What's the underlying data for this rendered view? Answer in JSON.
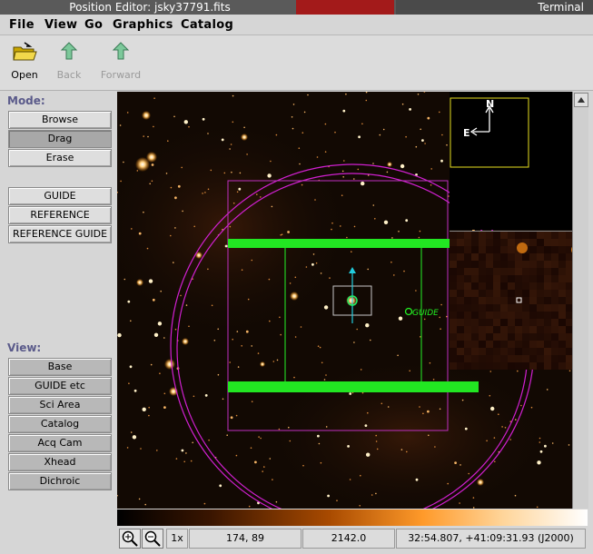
{
  "window": {
    "title": "Position Editor: jsky37791.fits",
    "other_window": "Terminal"
  },
  "menu": {
    "items": [
      "File",
      "View",
      "Go",
      "Graphics",
      "Catalog"
    ]
  },
  "toolbar": {
    "open": "Open",
    "back": "Back",
    "forward": "Forward"
  },
  "mode": {
    "label": "Mode:",
    "buttons": [
      "Browse",
      "Drag",
      "Erase"
    ],
    "selected": "Drag",
    "type_buttons": [
      "GUIDE",
      "REFERENCE",
      "REFERENCE GUIDE"
    ]
  },
  "view": {
    "label": "View:",
    "buttons": [
      "Base",
      "GUIDE etc",
      "Sci Area",
      "Catalog",
      "Acq Cam",
      "Xhead",
      "Dichroic"
    ]
  },
  "image": {
    "guide_label": "GUIDE",
    "compass_n": "N",
    "compass_e": "E"
  },
  "status": {
    "zoom": "1x",
    "pixel": "174, 89",
    "value": "2142.0",
    "wcs": "32:54.807, +41:09:31.93 (J2000)"
  }
}
